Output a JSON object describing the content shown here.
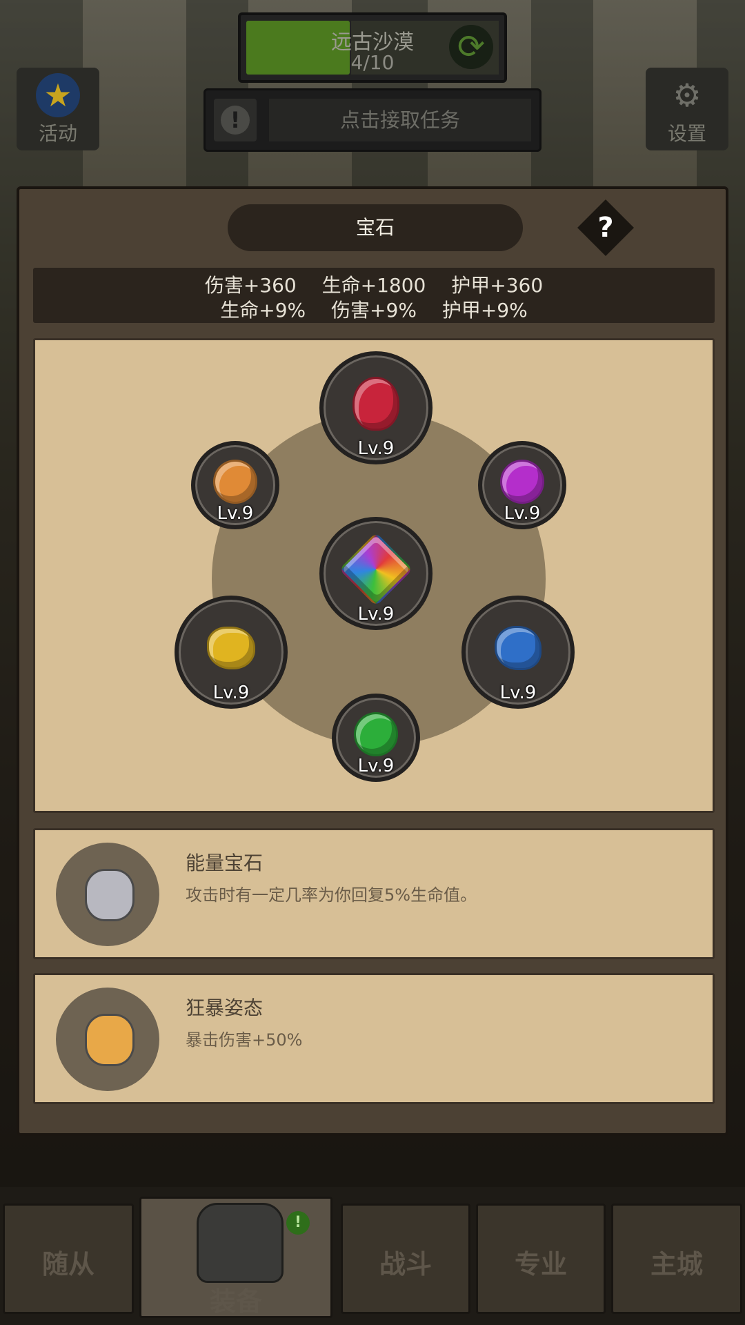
{
  "hud": {
    "stage_title": "远古沙漠",
    "stage_progress_text": "4/10",
    "stage_progress_fraction": 0.4,
    "task_button_label": "点击接取任务",
    "activity_label": "活动",
    "settings_label": "设置"
  },
  "modal": {
    "title": "宝石",
    "help_label": "?",
    "stats_row1": [
      "伤害+360",
      "生命+1800",
      "护甲+360"
    ],
    "stats_row2": [
      "生命+9%",
      "伤害+9%",
      "护甲+9%"
    ],
    "gems": [
      {
        "name": "red-gem",
        "level": "Lv.9",
        "color": "#c8243b"
      },
      {
        "name": "orange-gem",
        "level": "Lv.9",
        "color": "#e08a36"
      },
      {
        "name": "purple-gem",
        "level": "Lv.9",
        "color": "#b42ecb"
      },
      {
        "name": "rainbow-gem",
        "level": "Lv.9",
        "color": "#8fd04a"
      },
      {
        "name": "yellow-gem",
        "level": "Lv.9",
        "color": "#e0b420"
      },
      {
        "name": "blue-gem",
        "level": "Lv.9",
        "color": "#2f6fc8"
      },
      {
        "name": "green-gem",
        "level": "Lv.9",
        "color": "#2cae3a"
      }
    ],
    "skills": [
      {
        "name": "能量宝石",
        "desc": "攻击时有一定几率为你回复5%生命值。",
        "icon": "silver-gem-icon",
        "color": "#b8b8c0"
      },
      {
        "name": "狂暴姿态",
        "desc": "暴击伤害+50%",
        "icon": "amber-gem-icon",
        "color": "#e8a848"
      }
    ]
  },
  "nav": {
    "tabs": [
      "随从",
      "装备",
      "战斗",
      "专业",
      "主城"
    ],
    "active_tab": "装备",
    "equipment_badge": "!"
  }
}
